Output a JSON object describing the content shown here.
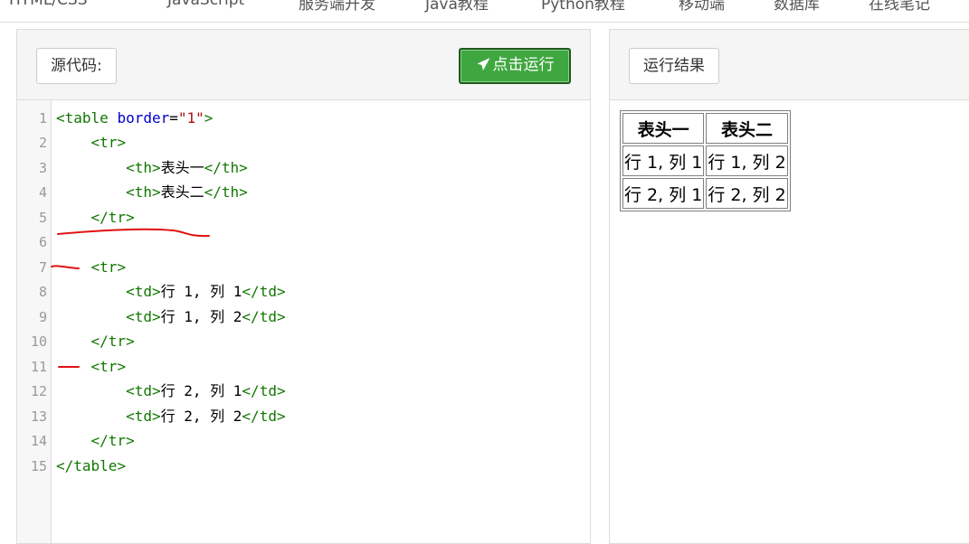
{
  "nav": {
    "items": [
      "HTML/CSS",
      "JavaScript",
      "服务端开发",
      "Java教程",
      "Python教程",
      "移动端",
      "数据库",
      "在线笔记"
    ]
  },
  "left_panel": {
    "source_label": "源代码:",
    "run_label": "点击运行",
    "code_lines": [
      "<table border=\"1\">",
      "    <tr>",
      "        <th>表头一</th>",
      "        <th>表头二</th>",
      "    </tr>",
      "",
      "    <tr>",
      "        <td>行 1, 列 1</td>",
      "        <td>行 1, 列 2</td>",
      "    </tr>",
      "    <tr>",
      "        <td>行 2, 列 1</td>",
      "        <td>行 2, 列 2</td>",
      "    </tr>",
      "</table>"
    ],
    "line_numbers": [
      "1",
      "2",
      "3",
      "4",
      "5",
      "6",
      "7",
      "8",
      "9",
      "10",
      "11",
      "12",
      "13",
      "14",
      "15"
    ]
  },
  "right_panel": {
    "result_label": "运行结果",
    "table": {
      "headers": [
        "表头一",
        "表头二"
      ],
      "rows": [
        [
          "行 1, 列 1",
          "行 1, 列 2"
        ],
        [
          "行 2, 列 1",
          "行 2, 列 2"
        ]
      ]
    }
  },
  "colors": {
    "run_button": "#3fa73f",
    "tag": "#117700",
    "attr": "#0000cc",
    "string": "#aa1111",
    "annotation": "#e01010"
  }
}
